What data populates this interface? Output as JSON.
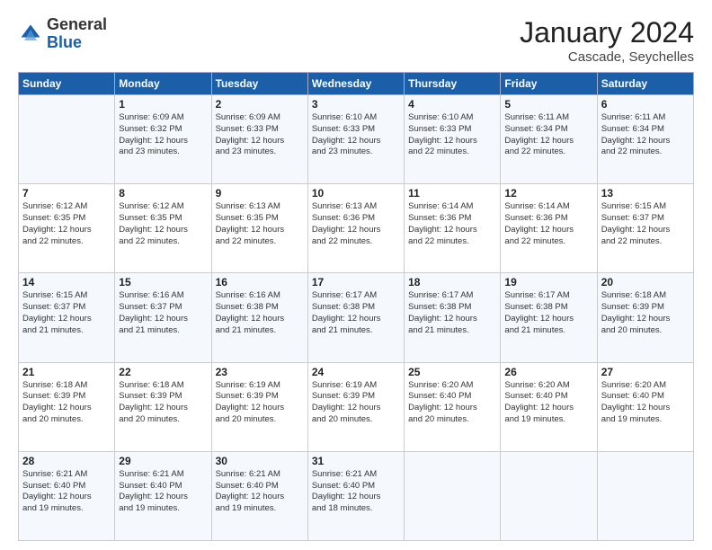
{
  "header": {
    "logo_general": "General",
    "logo_blue": "Blue",
    "month_title": "January 2024",
    "subtitle": "Cascade, Seychelles"
  },
  "days_of_week": [
    "Sunday",
    "Monday",
    "Tuesday",
    "Wednesday",
    "Thursday",
    "Friday",
    "Saturday"
  ],
  "weeks": [
    [
      {
        "day": "",
        "info": ""
      },
      {
        "day": "1",
        "info": "Sunrise: 6:09 AM\nSunset: 6:32 PM\nDaylight: 12 hours\nand 23 minutes."
      },
      {
        "day": "2",
        "info": "Sunrise: 6:09 AM\nSunset: 6:33 PM\nDaylight: 12 hours\nand 23 minutes."
      },
      {
        "day": "3",
        "info": "Sunrise: 6:10 AM\nSunset: 6:33 PM\nDaylight: 12 hours\nand 23 minutes."
      },
      {
        "day": "4",
        "info": "Sunrise: 6:10 AM\nSunset: 6:33 PM\nDaylight: 12 hours\nand 22 minutes."
      },
      {
        "day": "5",
        "info": "Sunrise: 6:11 AM\nSunset: 6:34 PM\nDaylight: 12 hours\nand 22 minutes."
      },
      {
        "day": "6",
        "info": "Sunrise: 6:11 AM\nSunset: 6:34 PM\nDaylight: 12 hours\nand 22 minutes."
      }
    ],
    [
      {
        "day": "7",
        "info": "Sunrise: 6:12 AM\nSunset: 6:35 PM\nDaylight: 12 hours\nand 22 minutes."
      },
      {
        "day": "8",
        "info": "Sunrise: 6:12 AM\nSunset: 6:35 PM\nDaylight: 12 hours\nand 22 minutes."
      },
      {
        "day": "9",
        "info": "Sunrise: 6:13 AM\nSunset: 6:35 PM\nDaylight: 12 hours\nand 22 minutes."
      },
      {
        "day": "10",
        "info": "Sunrise: 6:13 AM\nSunset: 6:36 PM\nDaylight: 12 hours\nand 22 minutes."
      },
      {
        "day": "11",
        "info": "Sunrise: 6:14 AM\nSunset: 6:36 PM\nDaylight: 12 hours\nand 22 minutes."
      },
      {
        "day": "12",
        "info": "Sunrise: 6:14 AM\nSunset: 6:36 PM\nDaylight: 12 hours\nand 22 minutes."
      },
      {
        "day": "13",
        "info": "Sunrise: 6:15 AM\nSunset: 6:37 PM\nDaylight: 12 hours\nand 22 minutes."
      }
    ],
    [
      {
        "day": "14",
        "info": "Sunrise: 6:15 AM\nSunset: 6:37 PM\nDaylight: 12 hours\nand 21 minutes."
      },
      {
        "day": "15",
        "info": "Sunrise: 6:16 AM\nSunset: 6:37 PM\nDaylight: 12 hours\nand 21 minutes."
      },
      {
        "day": "16",
        "info": "Sunrise: 6:16 AM\nSunset: 6:38 PM\nDaylight: 12 hours\nand 21 minutes."
      },
      {
        "day": "17",
        "info": "Sunrise: 6:17 AM\nSunset: 6:38 PM\nDaylight: 12 hours\nand 21 minutes."
      },
      {
        "day": "18",
        "info": "Sunrise: 6:17 AM\nSunset: 6:38 PM\nDaylight: 12 hours\nand 21 minutes."
      },
      {
        "day": "19",
        "info": "Sunrise: 6:17 AM\nSunset: 6:38 PM\nDaylight: 12 hours\nand 21 minutes."
      },
      {
        "day": "20",
        "info": "Sunrise: 6:18 AM\nSunset: 6:39 PM\nDaylight: 12 hours\nand 20 minutes."
      }
    ],
    [
      {
        "day": "21",
        "info": "Sunrise: 6:18 AM\nSunset: 6:39 PM\nDaylight: 12 hours\nand 20 minutes."
      },
      {
        "day": "22",
        "info": "Sunrise: 6:18 AM\nSunset: 6:39 PM\nDaylight: 12 hours\nand 20 minutes."
      },
      {
        "day": "23",
        "info": "Sunrise: 6:19 AM\nSunset: 6:39 PM\nDaylight: 12 hours\nand 20 minutes."
      },
      {
        "day": "24",
        "info": "Sunrise: 6:19 AM\nSunset: 6:39 PM\nDaylight: 12 hours\nand 20 minutes."
      },
      {
        "day": "25",
        "info": "Sunrise: 6:20 AM\nSunset: 6:40 PM\nDaylight: 12 hours\nand 20 minutes."
      },
      {
        "day": "26",
        "info": "Sunrise: 6:20 AM\nSunset: 6:40 PM\nDaylight: 12 hours\nand 19 minutes."
      },
      {
        "day": "27",
        "info": "Sunrise: 6:20 AM\nSunset: 6:40 PM\nDaylight: 12 hours\nand 19 minutes."
      }
    ],
    [
      {
        "day": "28",
        "info": "Sunrise: 6:21 AM\nSunset: 6:40 PM\nDaylight: 12 hours\nand 19 minutes."
      },
      {
        "day": "29",
        "info": "Sunrise: 6:21 AM\nSunset: 6:40 PM\nDaylight: 12 hours\nand 19 minutes."
      },
      {
        "day": "30",
        "info": "Sunrise: 6:21 AM\nSunset: 6:40 PM\nDaylight: 12 hours\nand 19 minutes."
      },
      {
        "day": "31",
        "info": "Sunrise: 6:21 AM\nSunset: 6:40 PM\nDaylight: 12 hours\nand 18 minutes."
      },
      {
        "day": "",
        "info": ""
      },
      {
        "day": "",
        "info": ""
      },
      {
        "day": "",
        "info": ""
      }
    ]
  ]
}
